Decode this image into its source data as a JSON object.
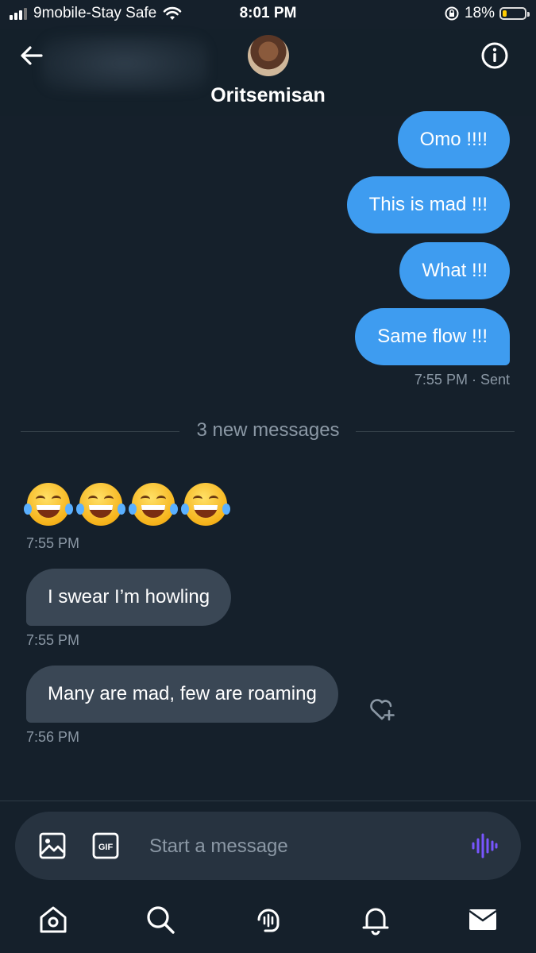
{
  "status_bar": {
    "carrier": "9mobile-Stay Safe",
    "time": "8:01 PM",
    "battery": "18%",
    "battery_level": 0.18
  },
  "header": {
    "contact_name": "Oritsemisan",
    "icons": {
      "back": "back-arrow-icon",
      "info": "info-icon"
    }
  },
  "sent_messages": [
    {
      "text": "Omo !!!!"
    },
    {
      "text": "This is mad !!!"
    },
    {
      "text": "What !!!"
    },
    {
      "text": "Same flow !!!"
    }
  ],
  "sent_meta": {
    "time": "7:55 PM",
    "status": "Sent"
  },
  "divider_label": "3 new messages",
  "received": {
    "emoji_message": {
      "emoji": "😂😂😂😂",
      "time": "7:55 PM"
    },
    "messages": [
      {
        "text": "I swear I’m howling",
        "time": "7:55 PM"
      },
      {
        "text": "Many are mad, few are roaming",
        "time": "7:56 PM"
      }
    ]
  },
  "composer": {
    "placeholder": "Start a message",
    "icons": {
      "media": "image-icon",
      "gif": "gif-icon",
      "voice": "voice-wave-icon"
    },
    "gif_label": "GIF"
  },
  "tab_bar": {
    "items": [
      "home-icon",
      "search-icon",
      "spaces-icon",
      "notifications-icon",
      "messages-icon"
    ]
  },
  "colors": {
    "background": "#15202b",
    "sent_bubble": "#3e9cf0",
    "received_bubble": "#3a4755",
    "muted_text": "#8b98a5",
    "voice_accent": "#7856ff"
  }
}
